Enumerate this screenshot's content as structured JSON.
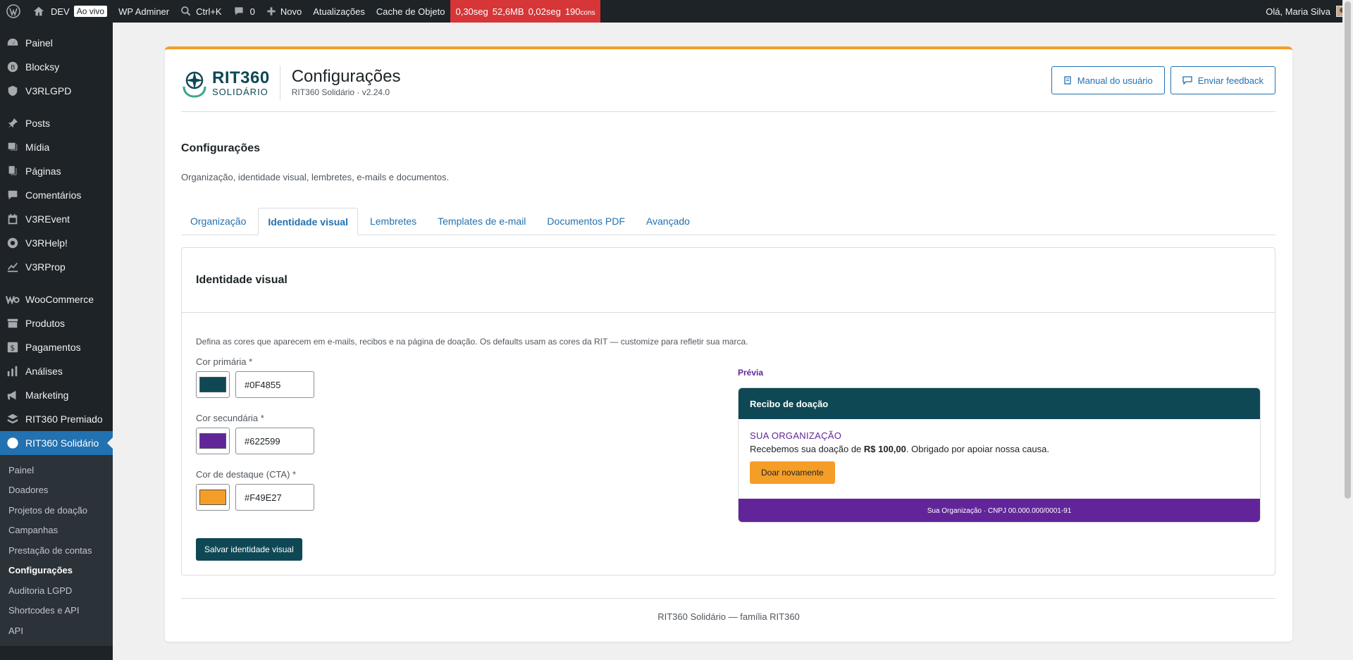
{
  "adminbar": {
    "site_name": "DEV",
    "live_badge": "Ao vivo",
    "adminer": "WP Adminer",
    "shortcut": "Ctrl+K",
    "comments_count": "0",
    "new_label": "Novo",
    "updates": "Atualizações",
    "object_cache": "Cache de Objeto",
    "perf_time": "0,30seg",
    "perf_mem": "52,6MB",
    "perf_query_time": "0,02seg",
    "perf_queries": "190",
    "perf_queries_unit": "cons",
    "greeting": "Olá, Maria Silva"
  },
  "sidebar": {
    "items": [
      {
        "label": "Painel",
        "icon": "dashboard-icon"
      },
      {
        "label": "Blocksy",
        "icon": "blocksy-icon"
      },
      {
        "label": "V3RLGPD",
        "icon": "shield-icon"
      },
      {
        "label": "Posts",
        "icon": "pin-icon"
      },
      {
        "label": "Mídia",
        "icon": "media-icon"
      },
      {
        "label": "Páginas",
        "icon": "pages-icon"
      },
      {
        "label": "Comentários",
        "icon": "comment-icon"
      },
      {
        "label": "V3REvent",
        "icon": "calendar-icon"
      },
      {
        "label": "V3RHelp!",
        "icon": "help-icon"
      },
      {
        "label": "V3RProp",
        "icon": "chart-line-icon"
      },
      {
        "label": "WooCommerce",
        "icon": "woo-icon"
      },
      {
        "label": "Produtos",
        "icon": "archive-icon"
      },
      {
        "label": "Pagamentos",
        "icon": "dollar-icon"
      },
      {
        "label": "Análises",
        "icon": "bar-chart-icon"
      },
      {
        "label": "Marketing",
        "icon": "megaphone-icon"
      },
      {
        "label": "RIT360 Premiado",
        "icon": "stack-icon"
      },
      {
        "label": "RIT360 Solidário",
        "icon": "circle-icon"
      }
    ],
    "submenu": [
      "Painel",
      "Doadores",
      "Projetos de doação",
      "Campanhas",
      "Prestação de contas",
      "Configurações",
      "Auditoria LGPD",
      "Shortcodes e API",
      "API"
    ]
  },
  "header": {
    "logo_main": "RIT360",
    "logo_sub": "SOLIDÁRIO",
    "title": "Configurações",
    "version": "RIT360 Solidário · v2.24.0",
    "manual_button": "Manual do usuário",
    "feedback_button": "Enviar feedback"
  },
  "page": {
    "heading": "Configurações",
    "description": "Organização, identidade visual, lembretes, e-mails e documentos."
  },
  "tabs": [
    "Organização",
    "Identidade visual",
    "Lembretes",
    "Templates de e-mail",
    "Documentos PDF",
    "Avançado"
  ],
  "panel": {
    "title": "Identidade visual",
    "description": "Defina as cores que aparecem em e-mails, recibos e na página de doação. Os defaults usam as cores da RIT — customize para refletir sua marca.",
    "fields": [
      {
        "label": "Cor primária *",
        "value": "#0F4855",
        "color": "#0F4855"
      },
      {
        "label": "Cor secundária *",
        "value": "#622599",
        "color": "#622599"
      },
      {
        "label": "Cor de destaque (CTA) *",
        "value": "#F49E27",
        "color": "#F49E27"
      }
    ],
    "save_button": "Salvar identidade visual"
  },
  "preview": {
    "label": "Prévia",
    "header": "Recibo de doação",
    "org": "SUA ORGANIZAÇÃO",
    "text_before": "Recebemos sua doação de ",
    "amount": "R$ 100,00",
    "text_after": ". Obrigado por apoiar nossa causa.",
    "cta": "Doar novamente",
    "footer": "Sua Organização · CNPJ 00.000.000/0001-91"
  },
  "footer": "RIT360 Solidário — família RIT360",
  "colors": {
    "primary": "#0F4855",
    "secondary": "#622599",
    "accent": "#F49E27",
    "wp_blue": "#2271b1",
    "perf_red": "#d63638"
  }
}
